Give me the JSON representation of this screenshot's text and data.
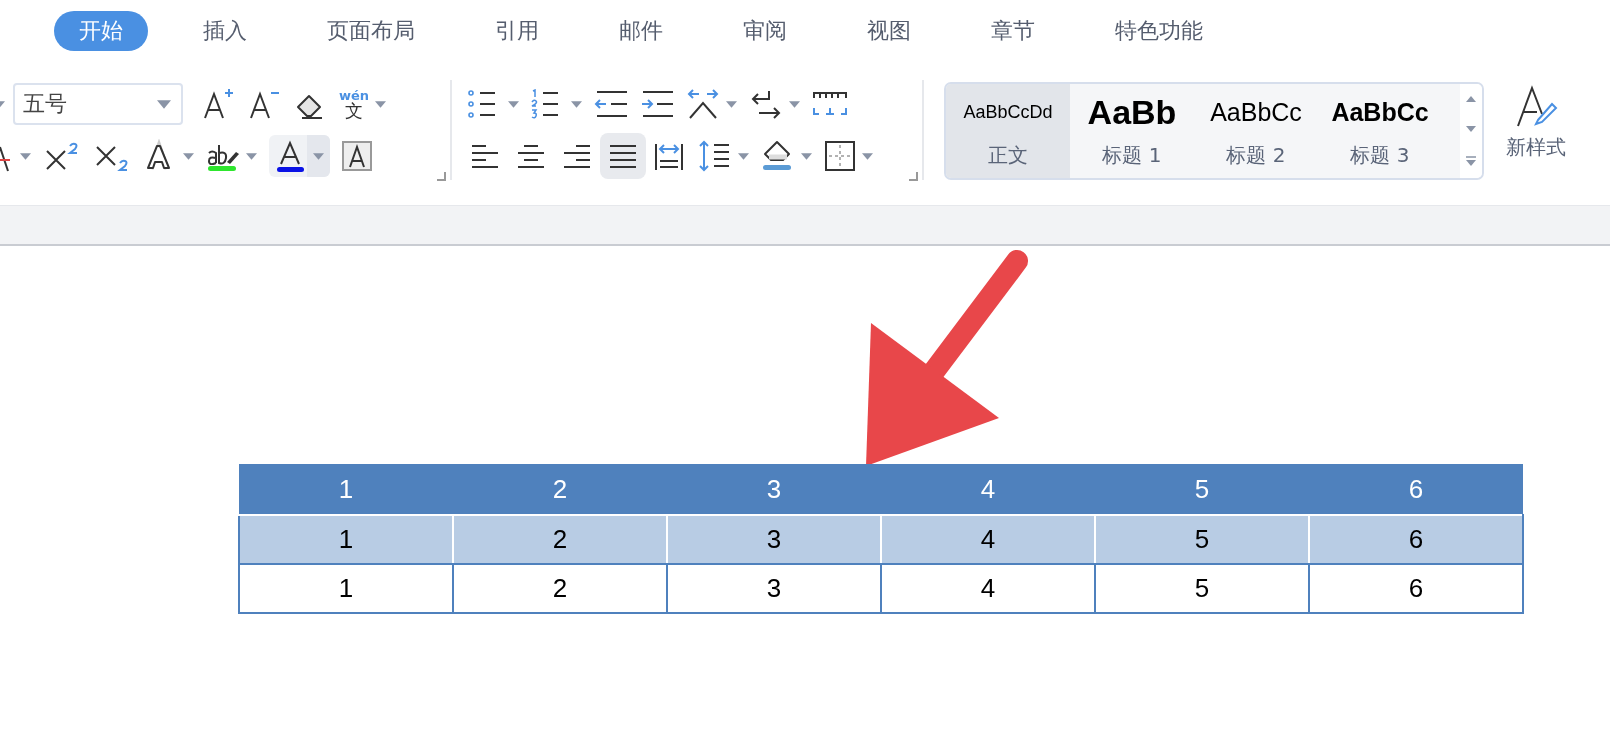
{
  "tabs": [
    {
      "label": "开始",
      "selected": true
    },
    {
      "label": "插入",
      "selected": false
    },
    {
      "label": "页面布局",
      "selected": false
    },
    {
      "label": "引用",
      "selected": false
    },
    {
      "label": "邮件",
      "selected": false
    },
    {
      "label": "审阅",
      "selected": false
    },
    {
      "label": "视图",
      "selected": false
    },
    {
      "label": "章节",
      "selected": false
    },
    {
      "label": "特色功能",
      "selected": false
    }
  ],
  "font": {
    "size_value": "五号",
    "phonetic_label": "wén",
    "phonetic_char": "文",
    "font_color_highlighted": true
  },
  "align_buttons": [
    {
      "kind": "left",
      "selected": false
    },
    {
      "kind": "center",
      "selected": false
    },
    {
      "kind": "right",
      "selected": false
    },
    {
      "kind": "justify",
      "selected": true
    },
    {
      "kind": "distribute",
      "selected": false
    }
  ],
  "styles": [
    {
      "preview": "AaBbCcDd",
      "label": "正文",
      "kind": "normal",
      "selected": true
    },
    {
      "preview": "AaBb",
      "label": "标题 1",
      "kind": "h1",
      "selected": false
    },
    {
      "preview": "AaBbCc",
      "label": "标题 2",
      "kind": "h2",
      "selected": false
    },
    {
      "preview": "AaBbCc",
      "label": "标题 3",
      "kind": "h3",
      "selected": false
    }
  ],
  "new_style": {
    "label": "新样式"
  },
  "table": {
    "rows": [
      {
        "kind": "header",
        "cells": [
          "1",
          "2",
          "3",
          "4",
          "5",
          "6"
        ]
      },
      {
        "kind": "band",
        "cells": [
          "1",
          "2",
          "3",
          "4",
          "5",
          "6"
        ]
      },
      {
        "kind": "plain",
        "cells": [
          "1",
          "2",
          "3",
          "4",
          "5",
          "6"
        ]
      }
    ]
  }
}
